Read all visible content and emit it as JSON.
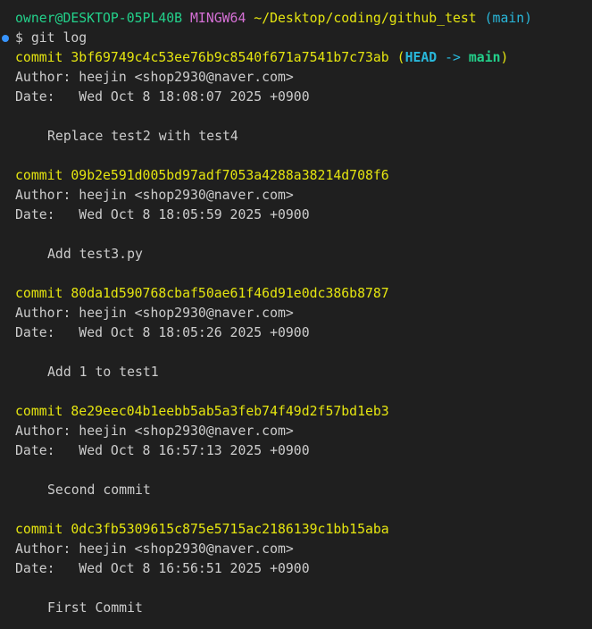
{
  "colors": {
    "background": "#1f1f1f",
    "text": "#cccccc",
    "user_host": "#23d18b",
    "msystem": "#d670d6",
    "path": "#e5e510",
    "branch": "#29b8db",
    "commit": "#e5e510",
    "prompt_dot": "#3794ff"
  },
  "prompt": {
    "user_host": "owner@DESKTOP-05PL40B",
    "msystem": "MINGW64",
    "path": "~/Desktop/coding/github_test",
    "branch": "(main)",
    "symbol": "$",
    "command": "git log"
  },
  "commits": [
    {
      "label": "commit",
      "hash": "3bf69749c4c53ee76b9c8540f671a7541b7c73ab",
      "refs": {
        "open": "(",
        "head": "HEAD",
        "arrow": "->",
        "branch": "main",
        "close": ")"
      },
      "author_label": "Author:",
      "author": "heejin <shop2930@naver.com>",
      "date_label": "Date:",
      "date": "Wed Oct 8 18:08:07 2025 +0900",
      "message": "Replace test2 with test4"
    },
    {
      "label": "commit",
      "hash": "09b2e591d005bd97adf7053a4288a38214d708f6",
      "author_label": "Author:",
      "author": "heejin <shop2930@naver.com>",
      "date_label": "Date:",
      "date": "Wed Oct 8 18:05:59 2025 +0900",
      "message": "Add test3.py"
    },
    {
      "label": "commit",
      "hash": "80da1d590768cbaf50ae61f46d91e0dc386b8787",
      "author_label": "Author:",
      "author": "heejin <shop2930@naver.com>",
      "date_label": "Date:",
      "date": "Wed Oct 8 18:05:26 2025 +0900",
      "message": "Add 1 to test1"
    },
    {
      "label": "commit",
      "hash": "8e29eec04b1eebb5ab5a3feb74f49d2f57bd1eb3",
      "author_label": "Author:",
      "author": "heejin <shop2930@naver.com>",
      "date_label": "Date:",
      "date": "Wed Oct 8 16:57:13 2025 +0900",
      "message": "Second commit"
    },
    {
      "label": "commit",
      "hash": "0dc3fb5309615c875e5715ac2186139c1bb15aba",
      "author_label": "Author:",
      "author": "heejin <shop2930@naver.com>",
      "date_label": "Date:",
      "date": "Wed Oct 8 16:56:51 2025 +0900",
      "message": "First Commit"
    }
  ]
}
